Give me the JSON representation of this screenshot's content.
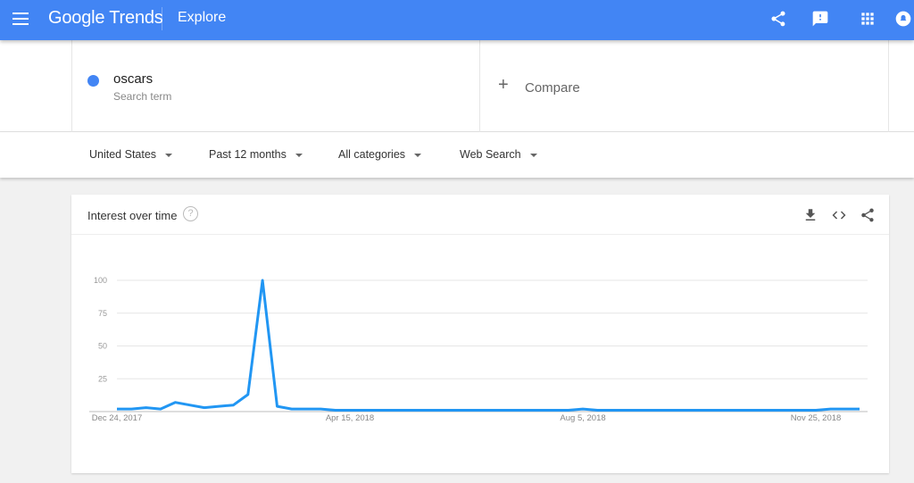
{
  "header": {
    "brand": "Google Trends",
    "section": "Explore",
    "color": "#4285f4",
    "icons": [
      "menu-icon",
      "share-icon",
      "feedback-icon",
      "apps-icon",
      "account-icon"
    ]
  },
  "search": {
    "term": "oscars",
    "term_subtitle": "Search term",
    "term_color": "#4285f4",
    "compare_label": "Compare"
  },
  "filters": [
    {
      "label": "United States"
    },
    {
      "label": "Past 12 months"
    },
    {
      "label": "All categories"
    },
    {
      "label": "Web Search"
    }
  ],
  "card": {
    "title": "Interest over time",
    "help": "?",
    "actions": [
      "download-icon",
      "embed-icon",
      "share-icon"
    ]
  },
  "chart_data": {
    "type": "line",
    "title": "Interest over time",
    "xlabel": "",
    "ylabel": "",
    "ylim": [
      0,
      100
    ],
    "yticks": [
      25,
      50,
      75,
      100
    ],
    "ytick_labels": [
      "25",
      "50",
      "75",
      "100"
    ],
    "xtick_labels": [
      "Dec 24, 2017",
      "Apr 15, 2018",
      "Aug 5, 2018",
      "Nov 25, 2018"
    ],
    "xtick_indices": [
      0,
      16,
      32,
      48
    ],
    "grid": true,
    "legend": "none",
    "series": [
      {
        "name": "oscars",
        "color": "#2196f3",
        "values": [
          2,
          2,
          3,
          2,
          7,
          5,
          3,
          4,
          5,
          13,
          100,
          4,
          2,
          2,
          2,
          1,
          1,
          1,
          1,
          1,
          1,
          1,
          1,
          1,
          1,
          1,
          1,
          1,
          1,
          1,
          1,
          1,
          2,
          1,
          1,
          1,
          1,
          1,
          1,
          1,
          1,
          1,
          1,
          1,
          1,
          1,
          1,
          1,
          1,
          2,
          2,
          2
        ]
      }
    ]
  }
}
